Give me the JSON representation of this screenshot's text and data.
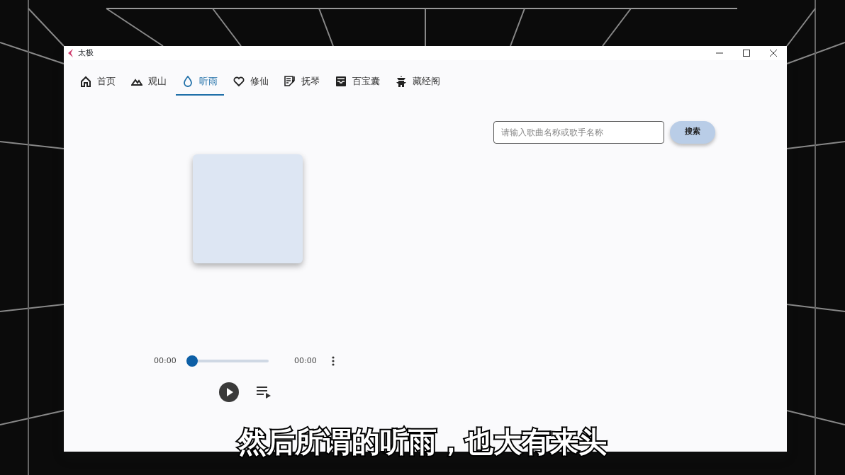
{
  "window": {
    "title": "太极"
  },
  "tabs": [
    {
      "label": "首页",
      "selected": false
    },
    {
      "label": "观山",
      "selected": false
    },
    {
      "label": "听雨",
      "selected": true
    },
    {
      "label": "修仙",
      "selected": false
    },
    {
      "label": "抚琴",
      "selected": false
    },
    {
      "label": "百宝囊",
      "selected": false
    },
    {
      "label": "藏经阁",
      "selected": false
    }
  ],
  "search": {
    "placeholder": "请输入歌曲名称或歌手名称",
    "button": "搜索"
  },
  "player": {
    "elapsed": "00:00",
    "duration": "00:00",
    "level": 0
  },
  "subtitle": "然后所谓的听雨，也大有来头"
}
